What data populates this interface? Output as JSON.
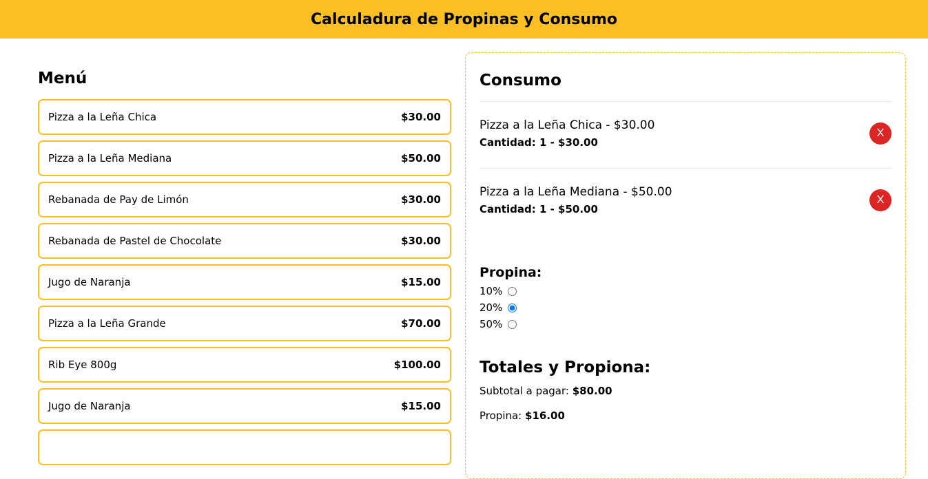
{
  "header": {
    "title": "Calculadura de Propinas y Consumo"
  },
  "menu": {
    "title": "Menú",
    "items": [
      {
        "name": "Pizza a la Leña Chica",
        "price": "$30.00"
      },
      {
        "name": "Pizza a la Leña Mediana",
        "price": "$50.00"
      },
      {
        "name": "Rebanada de Pay de Limón",
        "price": "$30.00"
      },
      {
        "name": "Rebanada de Pastel de Chocolate",
        "price": "$30.00"
      },
      {
        "name": "Jugo de Naranja",
        "price": "$15.00"
      },
      {
        "name": "Pizza a la Leña Grande",
        "price": "$70.00"
      },
      {
        "name": "Rib Eye 800g",
        "price": "$100.00"
      },
      {
        "name": "Jugo de Naranja",
        "price": "$15.00"
      }
    ]
  },
  "consumo": {
    "title": "Consumo",
    "items": [
      {
        "line1": "Pizza a la Leña Chica - $30.00",
        "line2": "Cantidad: 1 - $30.00",
        "remove_label": "X"
      },
      {
        "line1": "Pizza a la Leña Mediana - $50.00",
        "line2": "Cantidad: 1 - $50.00",
        "remove_label": "X"
      }
    ]
  },
  "tip": {
    "title": "Propina:",
    "options": [
      {
        "label": "10%",
        "checked": false
      },
      {
        "label": "20%",
        "checked": true
      },
      {
        "label": "50%",
        "checked": false
      }
    ]
  },
  "totals": {
    "title": "Totales y Propiona:",
    "subtotal_label": "Subtotal a pagar:",
    "subtotal_value": "$80.00",
    "tip_label": "Propina:",
    "tip_value": "$16.00"
  },
  "colors": {
    "accent": "#fbbf24",
    "danger": "#dc2626"
  }
}
